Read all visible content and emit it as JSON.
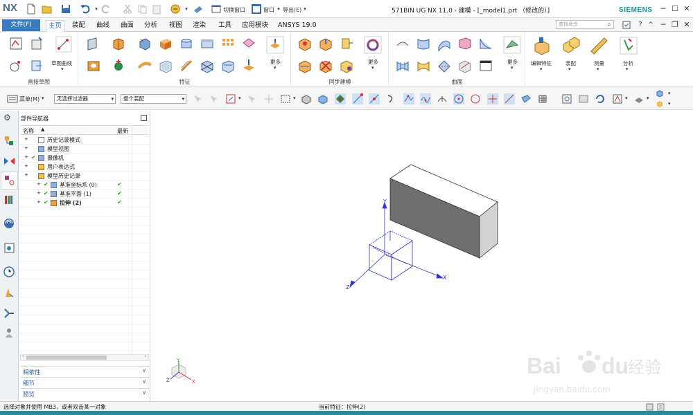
{
  "app": {
    "logo": "NX",
    "title": "571BIN UG NX 11.0 - 建模 - [_model1.prt （修改的）]",
    "brand": "SIEMENS"
  },
  "quick_access": {
    "switch_window": "切换窗口",
    "window": "窗口",
    "export": "导出(E)"
  },
  "tabs": [
    "主页",
    "装配",
    "曲线",
    "曲面",
    "分析",
    "视图",
    "渲染",
    "工具",
    "应用模块",
    "ANSYS 19.0"
  ],
  "file_tab": "文件(F)",
  "active_tab": "主页",
  "search": {
    "placeholder": "查找命令"
  },
  "ribbon": {
    "groups": [
      {
        "label": "直接草图",
        "items": [
          "草图曲线"
        ]
      },
      {
        "label": "特征",
        "items": [
          "更多"
        ]
      },
      {
        "label": "同步建模",
        "items": [
          "更多"
        ]
      },
      {
        "label": "曲面",
        "items": [
          "更多"
        ]
      }
    ],
    "right_buttons": [
      "编辑特征",
      "装配",
      "测量",
      "分析"
    ]
  },
  "command_bar": {
    "menu": "菜单(M)",
    "filter": "无选择过滤器",
    "scope": "整个装配"
  },
  "navigator": {
    "title": "部件导航器",
    "columns": [
      "名称",
      "最新"
    ],
    "rows": [
      {
        "label": "历史记录模式",
        "indent": 0,
        "checked": false,
        "latest": false,
        "bold": false
      },
      {
        "label": "模型视图",
        "indent": 0,
        "checked": false,
        "latest": false,
        "bold": false
      },
      {
        "label": "摄像机",
        "indent": 0,
        "checked": true,
        "latest": false,
        "bold": false
      },
      {
        "label": "用户表达式",
        "indent": 0,
        "checked": false,
        "latest": false,
        "bold": false
      },
      {
        "label": "模型历史记录",
        "indent": 0,
        "checked": false,
        "latest": false,
        "bold": false
      },
      {
        "label": "基准坐标系 (0)",
        "indent": 1,
        "checked": true,
        "latest": true,
        "bold": false
      },
      {
        "label": "基准平面 (1)",
        "indent": 1,
        "checked": true,
        "latest": true,
        "bold": false
      },
      {
        "label": "拉伸 (2)",
        "indent": 1,
        "checked": true,
        "latest": true,
        "bold": true
      }
    ],
    "panels": [
      "相依性",
      "细节",
      "预览"
    ]
  },
  "graphics": {
    "axes": [
      "X",
      "Y",
      "Z"
    ],
    "triad": [
      "X",
      "Y",
      "Z"
    ]
  },
  "status": {
    "prompt": "选择对象并使用 MB3，或者双击某一对象",
    "current_feature": "当前特征：拉伸(2)"
  },
  "watermark": {
    "text1": "Bai",
    "text2": "du",
    "cn": "经验",
    "url": "jingyan.baidu.com"
  },
  "colors": {
    "accent": "#3a7bbf",
    "brand": "#0a9a9a",
    "datum": "#3333cc",
    "check": "#22aa22"
  }
}
